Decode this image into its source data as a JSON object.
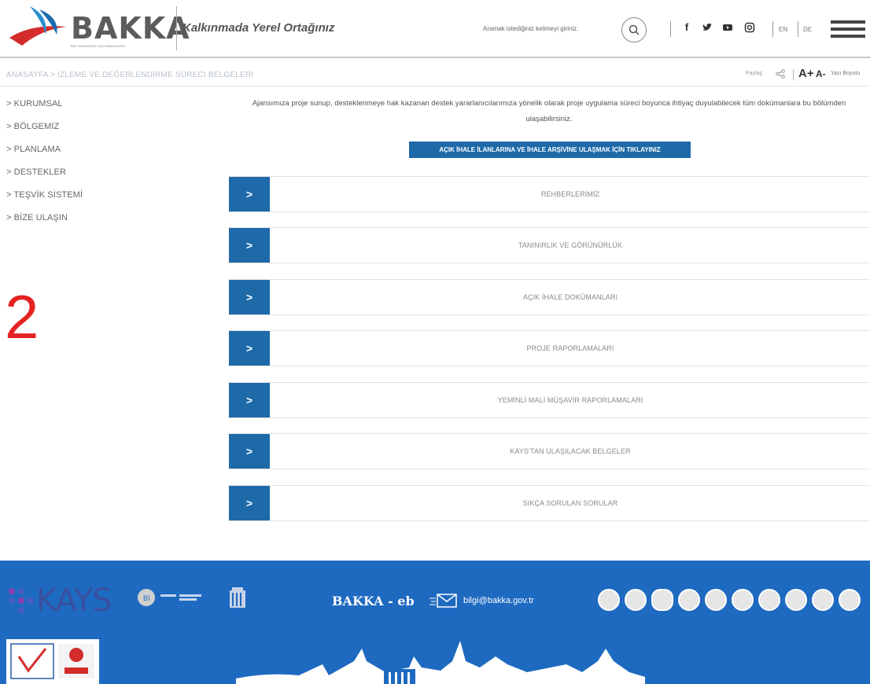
{
  "header": {
    "logo_text": "BAKKA",
    "logo_subtitle": "BATI KARADENİZ KALKINMA AJANSI",
    "tagline": "Kalkınmada Yerel Ortağınız",
    "search_placeholder": "Aramak istediğiniz kelimeyi giriniz.",
    "lang_en": "EN",
    "lang_de": "DE"
  },
  "breadcrumb": {
    "text": "ANASAYFA > İZLEME VE DEĞERLENDİRME SÜRECİ BELGELERİ",
    "share_label": "Paylaş",
    "font_up": "A+",
    "font_down": "A-",
    "font_label": "Yazı Boyutu"
  },
  "sidebar": {
    "items": [
      {
        "label": "> KURUMSAL"
      },
      {
        "label": "> BÖLGEMİZ"
      },
      {
        "label": "> PLANLAMA"
      },
      {
        "label": "> DESTEKLER"
      },
      {
        "label": "> TEŞVİK SİSTEMİ"
      },
      {
        "label": "> BİZE ULAŞIN"
      }
    ],
    "annotation": "2"
  },
  "main": {
    "intro": "Ajansımıza proje sunup, desteklenmeye hak kazanan destek yararlanıcılarımıza yönelik olarak proje uygulama süreci boyunca ihtiyaç duyulabilecek tüm dokümanlara bu bölümden ulaşabilirsiniz.",
    "cta_label": "AÇIK İHALE İLANLARINA VE İHALE ARŞİVİNE ULAŞMAK İÇİN TIKLAYINIZ",
    "accordion": [
      {
        "title": "REHBERLERİMİZ",
        "toggle": ">"
      },
      {
        "title": "TANINIRLIK VE GÖRÜNÜRLÜK",
        "toggle": ">"
      },
      {
        "title": "AÇIK İHALE DOKÜMANLARI",
        "toggle": ">"
      },
      {
        "title": "PROJE RAPORLAMALARI",
        "toggle": ">"
      },
      {
        "title": "YEMİNLİ MALİ MÜŞAVİR RAPORLAMALARI",
        "toggle": ">"
      },
      {
        "title": "KAYS'TAN ULAŞILACAK BELGELER",
        "toggle": ">"
      },
      {
        "title": "SIKÇA SORULAN SORULAR",
        "toggle": ">"
      }
    ]
  },
  "footer": {
    "kays": "KAYS",
    "bakka_eb": "BAKKA - eb",
    "email": "bilgi@bakka.gov.tr"
  },
  "colors": {
    "accent": "#1e6aa9",
    "footer_bg": "#1e6ac0",
    "annotation": "#e52222"
  }
}
